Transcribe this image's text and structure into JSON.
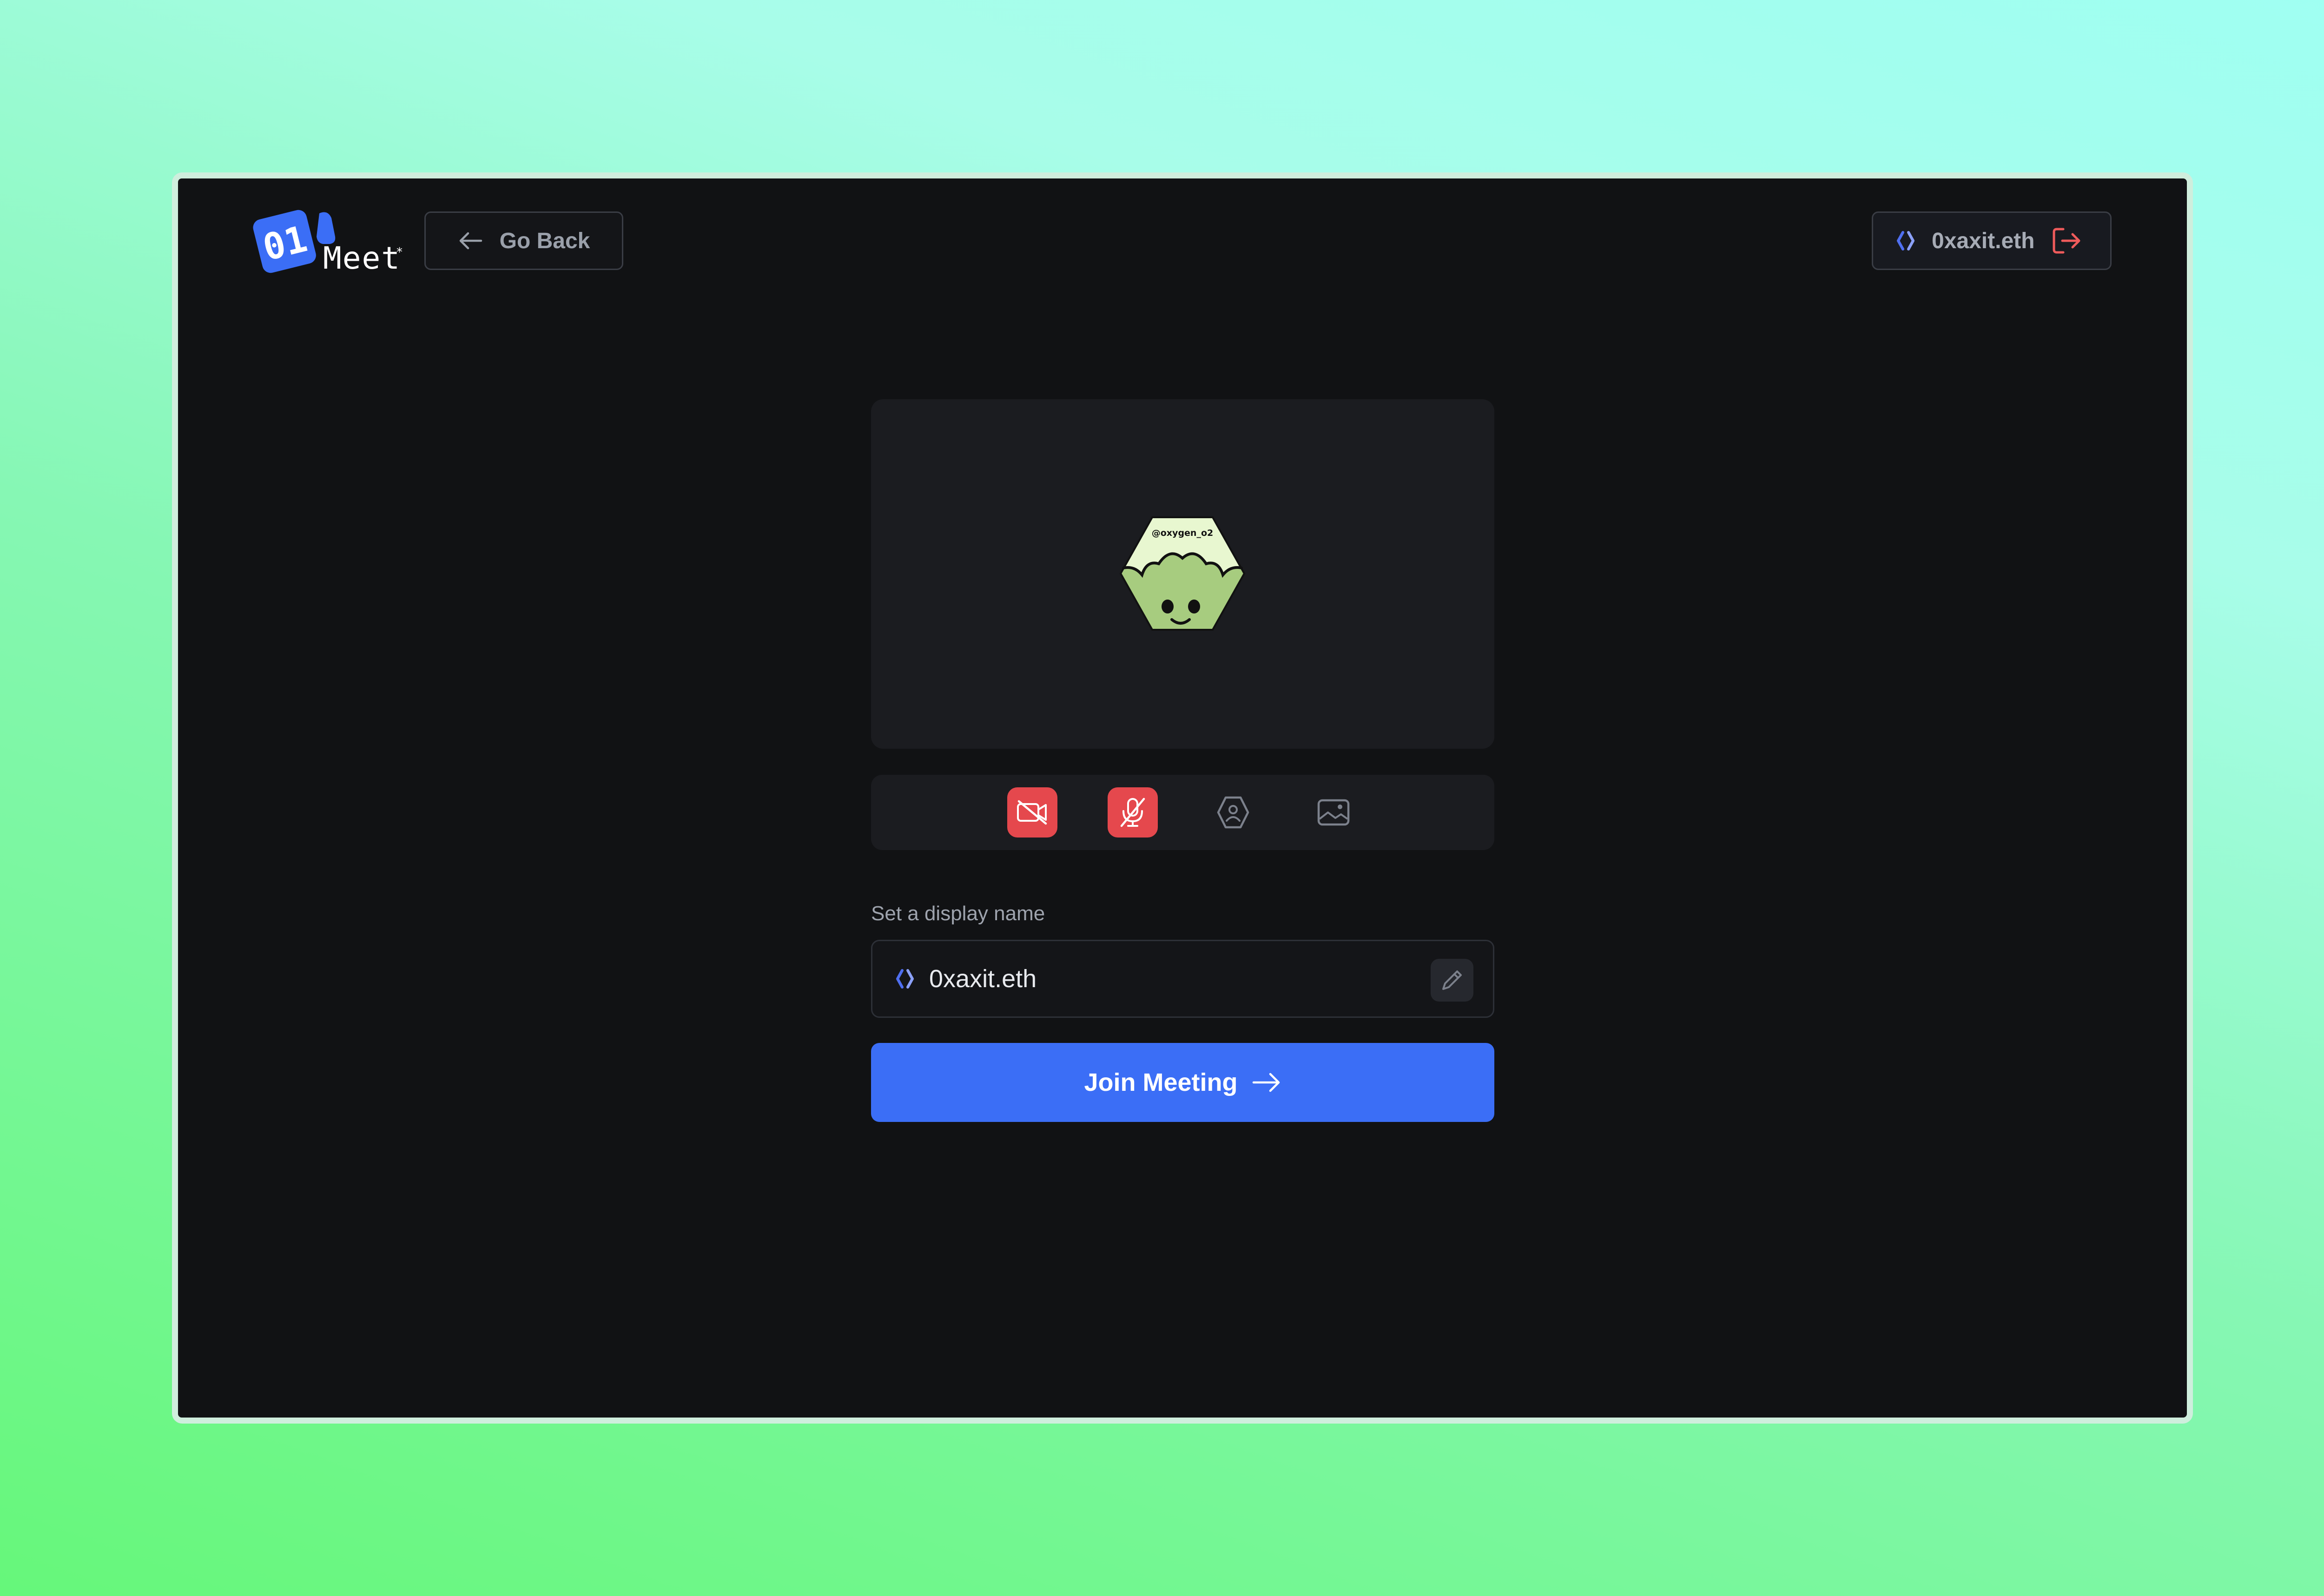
{
  "header": {
    "logo_text": "01 Meet",
    "go_back_label": "Go Back",
    "account_name": "0xaxit.eth"
  },
  "preview": {
    "avatar_handle": "@oxygen_o2"
  },
  "controls": [
    {
      "name": "camera",
      "state": "off",
      "icon": "video-off-icon"
    },
    {
      "name": "microphone",
      "state": "off",
      "icon": "mic-off-icon"
    },
    {
      "name": "avatar",
      "state": "default",
      "icon": "hexagon-user-icon"
    },
    {
      "name": "background",
      "state": "default",
      "icon": "image-icon"
    }
  ],
  "display_name": {
    "label": "Set a display name",
    "value": "0xaxit.eth"
  },
  "join_button": {
    "label": "Join Meeting"
  },
  "colors": {
    "accent": "#3b6ef6",
    "danger": "#e5484d",
    "background": "#111214",
    "panel": "#1b1c20"
  }
}
